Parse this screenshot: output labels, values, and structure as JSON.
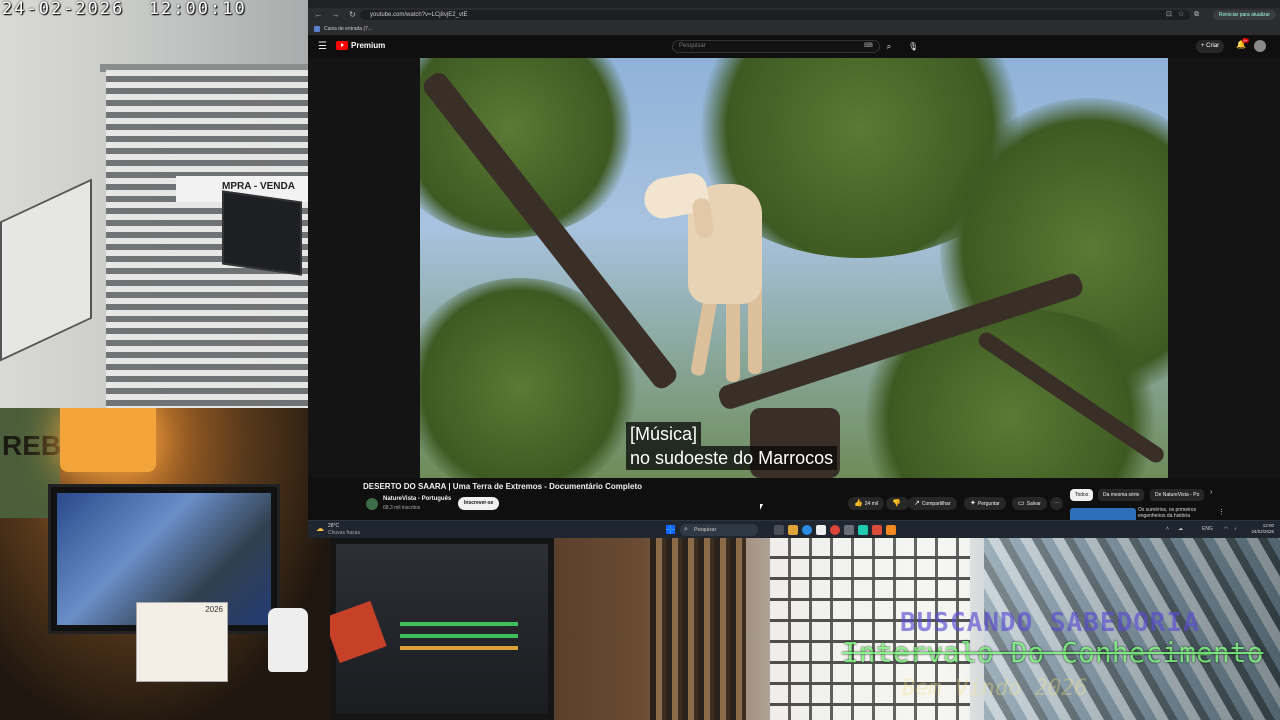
{
  "camera": {
    "timestamp": "24-02-2026  12:00:10",
    "sign_text": "MPRA - VENDA",
    "poster_text": "REB",
    "calendar_year": "2026"
  },
  "overlay": {
    "line1": "BUSCANDO SABEDORIA",
    "line2": "Intervalo Do Conhecimento",
    "line3": "Bem Vindo 2026"
  },
  "browser": {
    "url": "youtube.com/watch?v=LCj8vjE2_vtE",
    "restart_label": "Reiniciar para atualizar",
    "bookmark_label": "Caixa de entrada (7..."
  },
  "youtube": {
    "logo_text": "Premium",
    "search_placeholder": "Pesquisar",
    "create_label": "+ Criar",
    "notification_count": "9+",
    "subtitle_line1": "[Música]",
    "subtitle_line2": "no sudoeste do Marrocos",
    "video_title": "DESERTO DO SAARA | Uma Terra de Extremos - Documentário Completo",
    "channel_name": "NatureVista - Português",
    "channel_subs": "68,3 mil inscritos",
    "subscribe_label": "Inscrever-se",
    "like_count": "24 mil",
    "share_label": "Compartilhar",
    "ask_label": "Perguntar",
    "save_label": "Salvar",
    "more_label": "···",
    "chips": [
      "Todos",
      "Da mesma série",
      "De NatureVista - Po"
    ],
    "reco_title": "Os sumérios, os primeiros engenheiros da história"
  },
  "taskbar": {
    "temperature": "28°C",
    "weather_desc": "Chuvas fracas",
    "search_label": "Pesquisar",
    "language": "ENG",
    "time": "12:00",
    "date": "24/02/2026"
  }
}
